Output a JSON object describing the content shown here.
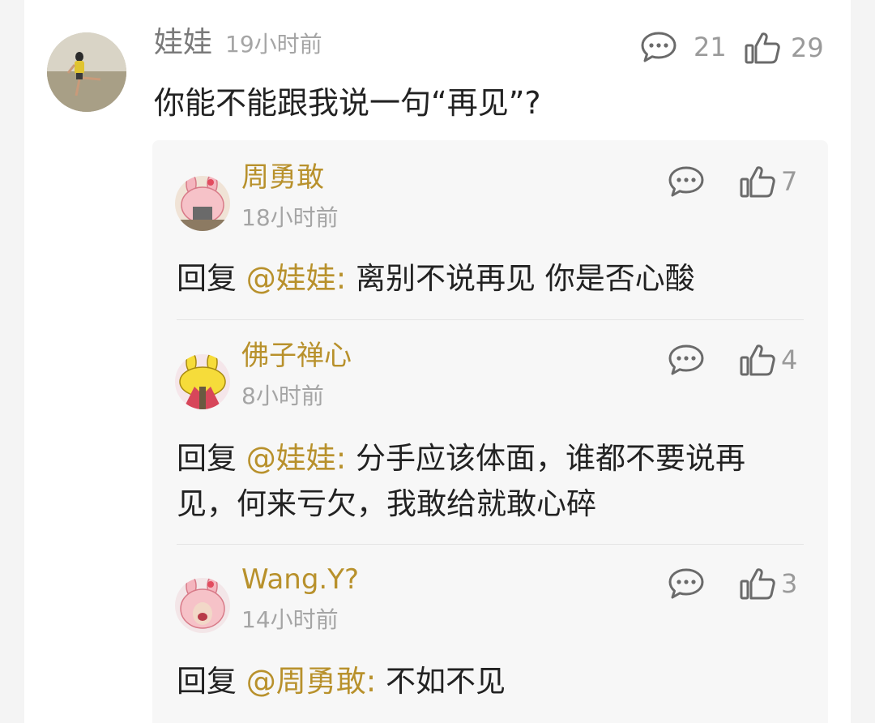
{
  "top_comment": {
    "author": "娃娃",
    "time": "19小时前",
    "body": "你能不能跟我说一句“再见”?",
    "comment_count": "21",
    "like_count": "29"
  },
  "replies": [
    {
      "name": "周勇敢",
      "time": "18小时前",
      "like_count": "7",
      "reply_prefix": "回复",
      "mention": "@娃娃:",
      "text": "离别不说再见 你是否心酸"
    },
    {
      "name": "佛子禅心",
      "time": "8小时前",
      "like_count": "4",
      "reply_prefix": "回复",
      "mention": "@娃娃:",
      "text": "分手应该体面，谁都不要说再见，何来亏欠，我敢给就敢心碎"
    },
    {
      "name": "Wang.Y?",
      "time": "14小时前",
      "like_count": "3",
      "reply_prefix": "回复",
      "mention": "@周勇敢:",
      "text": "不如不见"
    }
  ],
  "colors": {
    "accent": "#b8912c",
    "muted": "#a5a5a5",
    "text": "#222222",
    "reply_bg": "#f7f7f7"
  }
}
